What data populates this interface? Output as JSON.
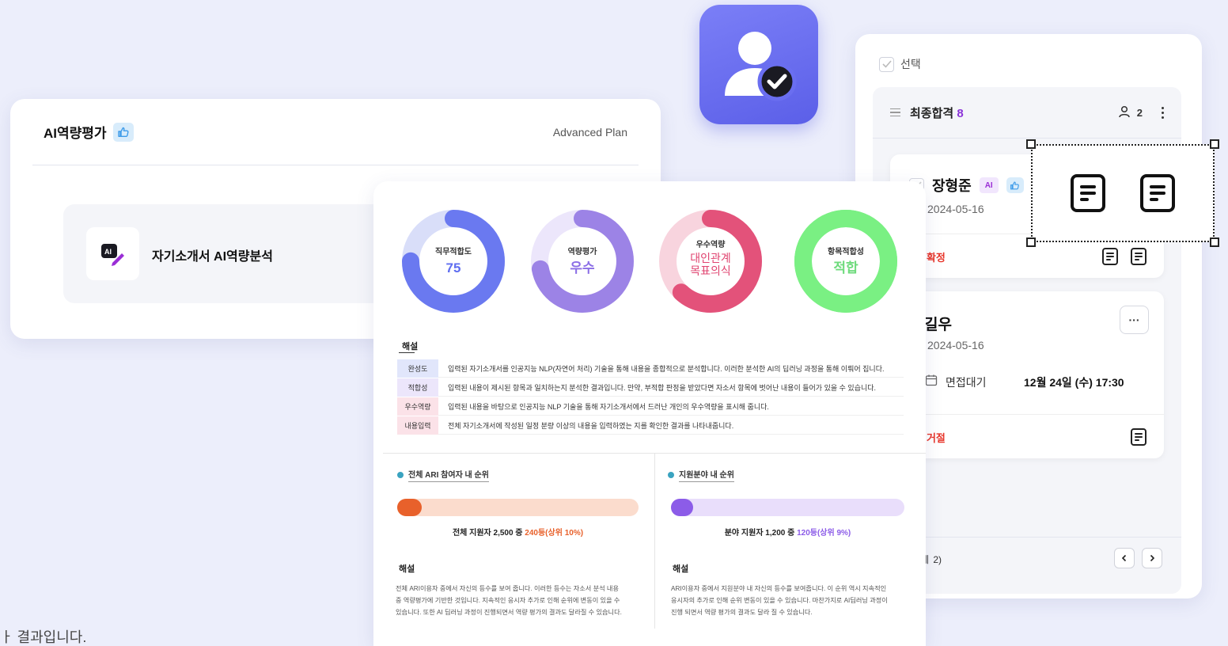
{
  "ai_card": {
    "title": "AI역량평가",
    "plan": "Advanced Plan",
    "item_label": "자기소개서 AI역량분석"
  },
  "right_panel": {
    "select_label": "선택",
    "column": {
      "title": "최종합격",
      "count": "8",
      "assignee_count": "2"
    },
    "candidate1": {
      "name": "장형준",
      "ai_badge": "AI",
      "date": "2024-05-16",
      "status": "· 확정"
    },
    "candidate2": {
      "name": "길우",
      "date": "2024-05-16",
      "schedule_label": "면접대기",
      "schedule_time": "12월 24일 (수) 17:30",
      "status": "· 거절",
      "more": "···"
    },
    "pager": {
      "text": "ㅔ 2)"
    }
  },
  "report": {
    "donuts": [
      {
        "label": "직무적합도",
        "value": "75",
        "fraction": 0.75,
        "color": "#6a79f0",
        "track": "#d9def9",
        "value_color": "#5f6ef0"
      },
      {
        "label": "역량평가",
        "value": "우수",
        "fraction": 0.72,
        "color": "#9c83e6",
        "track": "#ece6fb",
        "value_color": "#8b6ee6"
      },
      {
        "label": "우수역량",
        "value": "대인관계 목표의식",
        "value_lines": [
          "대인관계",
          "목표의식"
        ],
        "fraction": 0.62,
        "color": "#e3527a",
        "track": "#f8d4de",
        "value_color": "#e04470"
      },
      {
        "label": "항목적합성",
        "value": "적합",
        "fraction": 1.0,
        "color": "#7af083",
        "track": "#7af083",
        "value_color": "#6fdb7d"
      }
    ],
    "explanation_title": "해설",
    "explanations": [
      {
        "tag": "완성도",
        "tag_bg": "#e1e6fb",
        "text": "입력된 자기소개서를 인공지능 NLP(자연어 처리) 기술을 통해 내용을 종합적으로 분석합니다. 이러한 분석한 AI의 딥러닝 과정을 통해 이뤄어 집니다."
      },
      {
        "tag": "적합성",
        "tag_bg": "#ece6fb",
        "text": "입력된 내용이 제시된 항목과 일치하는지 분석한 결과입니다. 만약, 부적합 판정을 받았다면 자소서 항목에 벗어난 내용이 들어가 있을 수 있습니다."
      },
      {
        "tag": "우수역량",
        "tag_bg": "#fbe2e8",
        "text": "입력된 내용을 바탕으로 인공지능 NLP 기술을 통해 자기소개서에서 드러난 개인의 우수역량을 표시해 줍니다."
      },
      {
        "tag": "내용입력",
        "tag_bg": "#fbe2e8",
        "text": "전체 자기소개서에 작성된 일정 분량 이상의 내용을 입력하였는 지를 확인한 결과를 나타내줍니다."
      }
    ],
    "rank_left": {
      "title": "전체 ARI 참여자 내 순위",
      "fraction": 0.1,
      "bar_color": "#e8612b",
      "track_color": "#fbdccd",
      "text_prefix": "전체 지원자 2,500 중 ",
      "text_highlight": "240등(상위 10%)",
      "highlight_color": "#e8612b",
      "expl_title": "해설",
      "expl_lines": [
        "전체 ARI이용자 중에서 자신의 등수를 보여 줍니다. 이러한 등수는 자소서 분석 내용",
        "중 역량평가에 기반한 것입니다. 지속적인 응시자 추가로 인해 순위에 변동이 있을 수",
        "있습니다. 또한 AI 딥러닝 과정이 진행되면서 역량 평가의 결과도 달라질 수 있습니다."
      ]
    },
    "rank_right": {
      "title": "지원분야 내 순위",
      "fraction": 0.09,
      "bar_color": "#8c5ce8",
      "track_color": "#e9defb",
      "text_prefix": "분야 지원자 1,200 중 ",
      "text_highlight": "120등(상위 9%)",
      "highlight_color": "#8c5ce8",
      "expl_title": "해설",
      "expl_lines": [
        "ARI이용자 중에서 지원분야 내 자신의 등수를 보여줍니다. 이 순위 역시 지속적인",
        "응시자의 추가로 인해 순위 변동이 있을 수 있습니다. 마찬가지로 AI딥러닝 과정이",
        "진행 되면서 역량 평가의 결과도 달라 질 수 있습니다."
      ]
    }
  },
  "footer_text": "ㅏ 결과입니다."
}
